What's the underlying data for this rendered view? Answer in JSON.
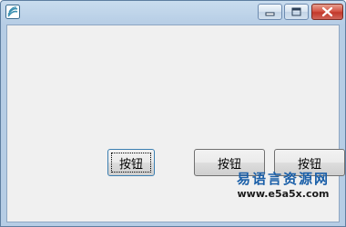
{
  "window": {
    "icon": "app-icon",
    "controls": {
      "minimize_icon": "minimize-icon",
      "maximize_icon": "maximize-icon",
      "close_icon": "close-icon"
    }
  },
  "buttons": [
    {
      "label": "按钮",
      "focused": true
    },
    {
      "label": "按钮",
      "focused": false
    },
    {
      "label": "按钮",
      "focused": false
    }
  ],
  "watermark": {
    "text": "易语言资源网",
    "url": "www.e5a5x.com"
  },
  "colors": {
    "close_button": "#c2392b",
    "watermark_text": "#1a5fa8"
  }
}
